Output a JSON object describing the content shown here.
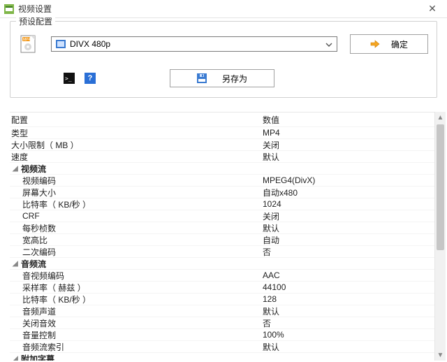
{
  "window": {
    "title": "视频设置",
    "close_glyph": "✕"
  },
  "group": {
    "legend": "预设配置",
    "preset_selected": "DIVX 480p",
    "confirm_label": "确定",
    "saveas_label": "另存为",
    "help_glyph": "?"
  },
  "grid": {
    "header_name": "配置",
    "header_value": "数值",
    "rows": [
      {
        "kind": "plain",
        "indent": 0,
        "name": "类型",
        "value": "MP4"
      },
      {
        "kind": "plain",
        "indent": 0,
        "name": "大小限制（ MB ）",
        "value": "关闭"
      },
      {
        "kind": "plain",
        "indent": 0,
        "name": "速度",
        "value": "默认"
      },
      {
        "kind": "group",
        "indent": 0,
        "name": "视频流",
        "value": ""
      },
      {
        "kind": "plain",
        "indent": 1,
        "name": "视频编码",
        "value": "MPEG4(DivX)"
      },
      {
        "kind": "plain",
        "indent": 1,
        "name": "屏幕大小",
        "value": "自动x480"
      },
      {
        "kind": "plain",
        "indent": 1,
        "name": "比特率（ KB/秒 ）",
        "value": "1024"
      },
      {
        "kind": "disabled",
        "indent": 1,
        "name": "CRF",
        "value": "关闭"
      },
      {
        "kind": "plain",
        "indent": 1,
        "name": "每秒桢数",
        "value": "默认"
      },
      {
        "kind": "plain",
        "indent": 1,
        "name": "宽高比",
        "value": "自动"
      },
      {
        "kind": "plain",
        "indent": 1,
        "name": "二次编码",
        "value": "否"
      },
      {
        "kind": "group",
        "indent": 0,
        "name": "音频流",
        "value": ""
      },
      {
        "kind": "plain",
        "indent": 1,
        "name": "音视频编码",
        "value": "AAC"
      },
      {
        "kind": "plain",
        "indent": 1,
        "name": "采样率（ 赫兹 ）",
        "value": "44100"
      },
      {
        "kind": "plain",
        "indent": 1,
        "name": "比特率（ KB/秒 ）",
        "value": "128"
      },
      {
        "kind": "plain",
        "indent": 1,
        "name": "音频声道",
        "value": "默认"
      },
      {
        "kind": "plain",
        "indent": 1,
        "name": "关闭音效",
        "value": "否"
      },
      {
        "kind": "plain",
        "indent": 1,
        "name": "音量控制",
        "value": "100%"
      },
      {
        "kind": "plain",
        "indent": 1,
        "name": "音频流索引",
        "value": "默认"
      },
      {
        "kind": "group",
        "indent": 0,
        "name": "附加字幕",
        "value": ""
      }
    ]
  }
}
